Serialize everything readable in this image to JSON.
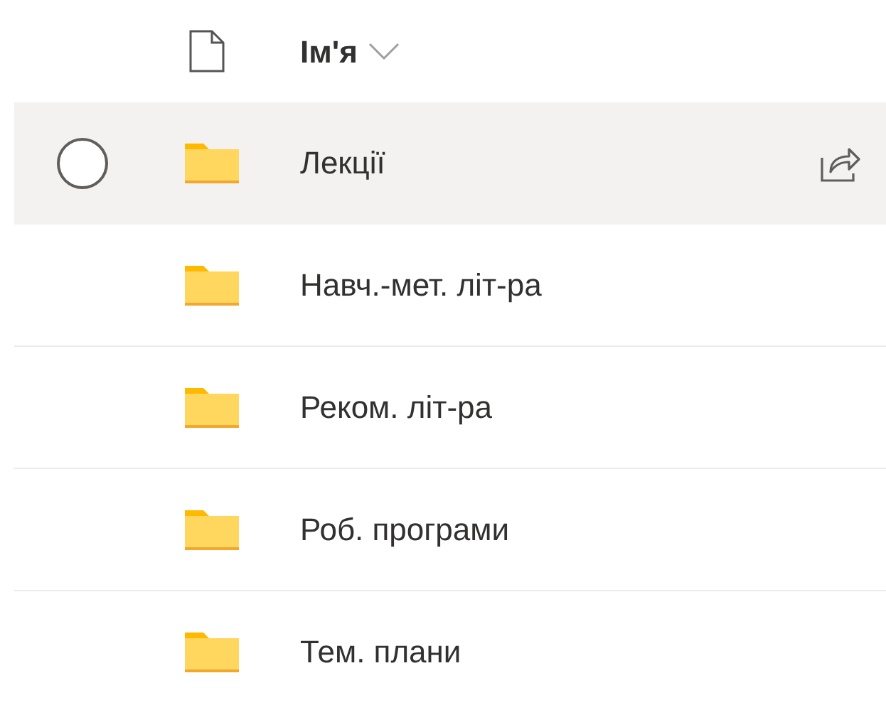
{
  "header": {
    "name_column": "Ім'я"
  },
  "rows": [
    {
      "name": "Лекції",
      "hovered": true
    },
    {
      "name": "Навч.-мет. літ-ра",
      "hovered": false
    },
    {
      "name": "Реком. літ-ра",
      "hovered": false
    },
    {
      "name": "Роб. програми",
      "hovered": false
    },
    {
      "name": "Тем. плани",
      "hovered": false
    }
  ]
}
